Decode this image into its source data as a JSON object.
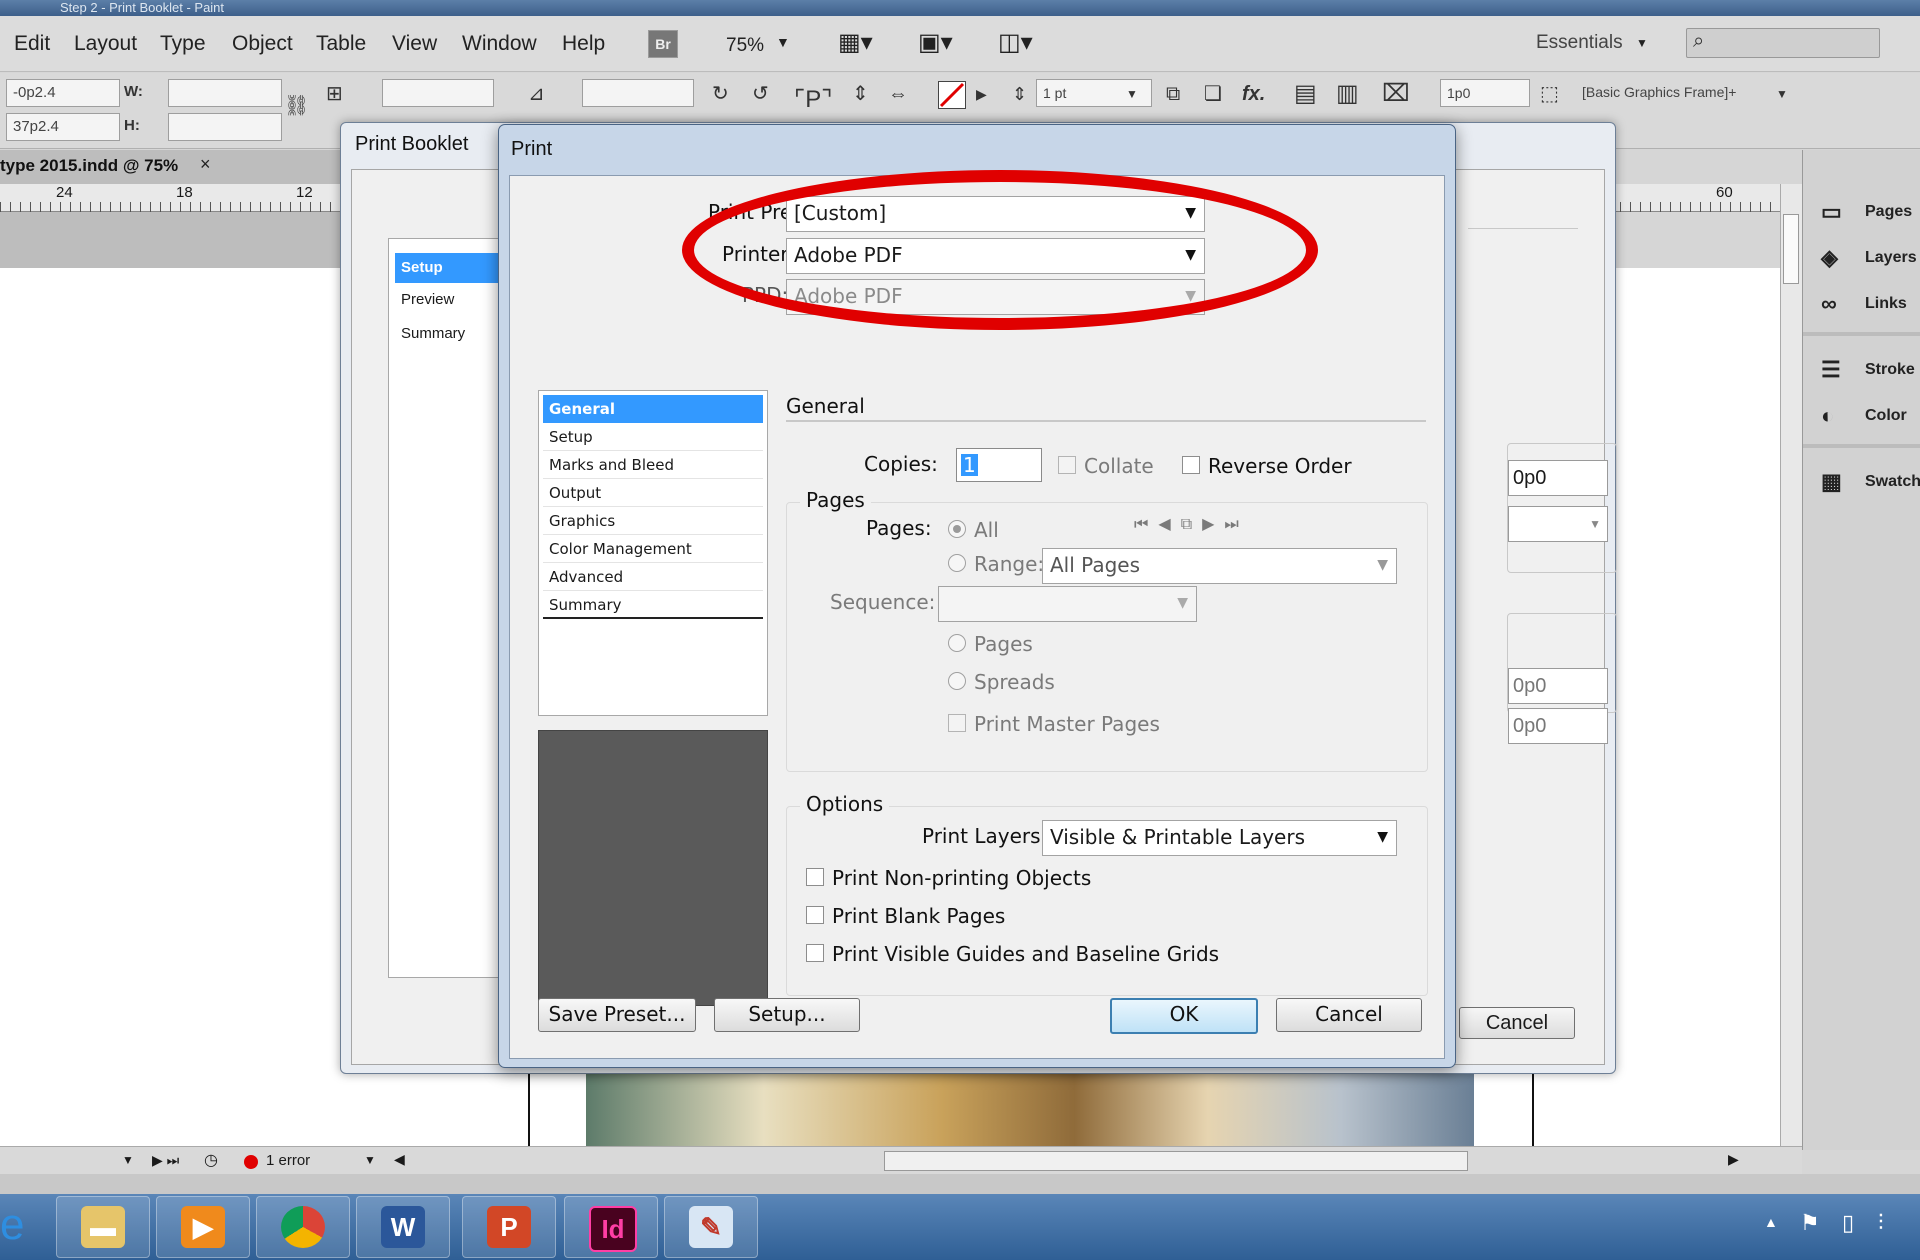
{
  "window": {
    "title_fragment": "Step 2 - Print Booklet - Paint"
  },
  "menubar": {
    "items": [
      "Edit",
      "Layout",
      "Type",
      "Object",
      "Table",
      "View",
      "Window",
      "Help"
    ],
    "bridge": "Br",
    "zoom": "75%",
    "workspace": "Essentials",
    "search_placeholder": ""
  },
  "controlbar": {
    "x": "-0p2.4",
    "y": "37p2.4",
    "w_label": "W:",
    "h_label": "H:",
    "stroke_weight": "1 pt",
    "offset": "1p0",
    "object_style": "[Basic Graphics Frame]+"
  },
  "document": {
    "tab_title": "type 2015.indd @ 75%",
    "tab_close": "×",
    "ruler_left": [
      "24",
      "18",
      "12"
    ],
    "ruler_right": [
      "60"
    ]
  },
  "panels": {
    "items": [
      "Pages",
      "Layers",
      "Links",
      "Stroke",
      "Color",
      "Swatches"
    ]
  },
  "statusbar": {
    "errors": "1 error"
  },
  "taskbar": {
    "word": "W",
    "powerpoint": "P",
    "indesign": "Id"
  },
  "booklet": {
    "title": "Print Booklet",
    "nav": [
      "Setup",
      "Preview",
      "Summary"
    ],
    "field1": "0p0",
    "field3": "0p0",
    "field4": "0p0",
    "cancel": "Cancel"
  },
  "print": {
    "title": "Print",
    "preset_label": "Print Preset:",
    "preset_value": "[Custom]",
    "printer_label": "Printer:",
    "printer_value": "Adobe PDF",
    "ppd_label": "PPD:",
    "ppd_value": "Adobe PDF",
    "nav": [
      "General",
      "Setup",
      "Marks and Bleed",
      "Output",
      "Graphics",
      "Color Management",
      "Advanced",
      "Summary"
    ],
    "section_title": "General",
    "copies_label": "Copies:",
    "copies_value": "1",
    "collate": "Collate",
    "reverse_order": "Reverse Order",
    "pages_group": "Pages",
    "pages_label": "Pages:",
    "all": "All",
    "range_label": "Range:",
    "range_value": "All Pages",
    "sequence_label": "Sequence:",
    "opt_pages": "Pages",
    "opt_spreads": "Spreads",
    "print_master": "Print Master Pages",
    "options_group": "Options",
    "layers_label": "Print Layers:",
    "layers_value": "Visible & Printable Layers",
    "nonprinting": "Print Non-printing Objects",
    "blank_pages": "Print Blank Pages",
    "guides": "Print Visible Guides and Baseline Grids",
    "save_preset": "Save Preset...",
    "setup": "Setup...",
    "ok": "OK",
    "cancel": "Cancel"
  },
  "colors": {
    "accent": "#3399ff",
    "annotation": "#e00000"
  }
}
